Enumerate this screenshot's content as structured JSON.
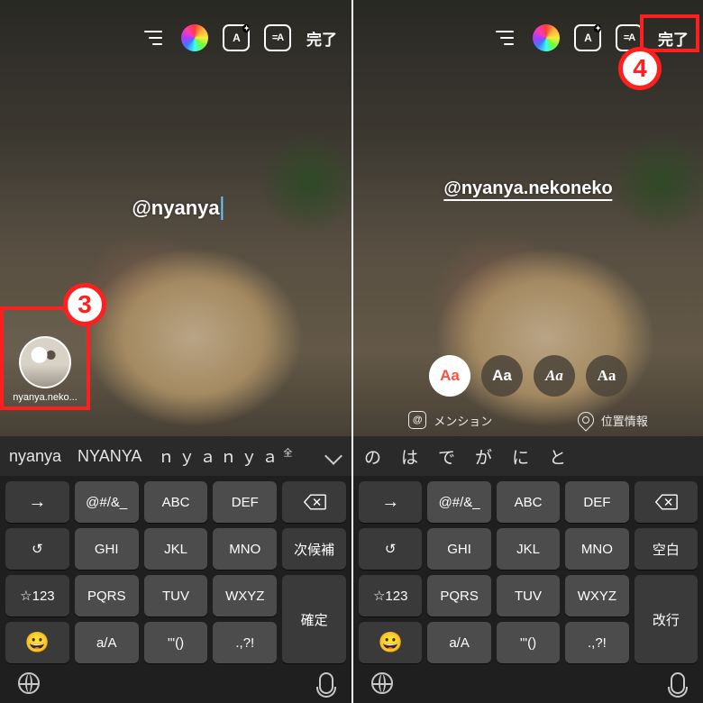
{
  "header": {
    "done_label": "完了"
  },
  "annotations": {
    "step3": "3",
    "step4": "4"
  },
  "left_screen": {
    "mention_text": "@nyanya",
    "suggestion_user": "nyanya.neko...",
    "suggestion_bar": {
      "items": [
        "nyanya",
        "NYANYA",
        "ｎｙａｎｙａ"
      ],
      "superscript": "全"
    }
  },
  "right_screen": {
    "mention_text": "@nyanya.nekoneko",
    "font_styles": [
      "Aa",
      "Aa",
      "Aa",
      "Aa"
    ],
    "quick_actions": {
      "mention_label": "メンション",
      "location_label": "位置情報"
    },
    "suggestion_bar": {
      "items": [
        "の",
        "は",
        "で",
        "が",
        "に",
        "と"
      ]
    }
  },
  "keyboard": {
    "rows": [
      [
        "→",
        "@#/&_",
        "ABC",
        "DEF"
      ],
      [
        "GHI",
        "JKL",
        "MNO"
      ],
      [
        "☆123",
        "PQRS",
        "TUV",
        "WXYZ"
      ],
      [
        "a/A",
        "'\"()",
        ".,?!"
      ]
    ],
    "undo": "↺",
    "emoji": "😀",
    "left_side": {
      "next_candidate": "次候補",
      "confirm": "確定"
    },
    "right_side": {
      "space": "空白",
      "return": "改行"
    }
  }
}
